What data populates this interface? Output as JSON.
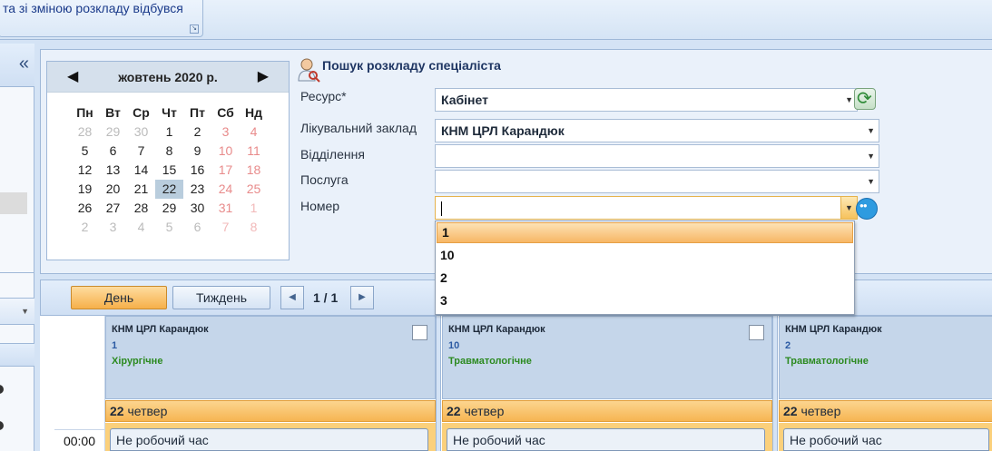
{
  "ribbon": {
    "group_text": "та  зі зміною розкладу  відбувся"
  },
  "calendar": {
    "month_title": "жовтень 2020 р.",
    "weekdays": [
      "Пн",
      "Вт",
      "Ср",
      "Чт",
      "Пт",
      "Сб",
      "Нд"
    ],
    "weeks": [
      [
        "28",
        "29",
        "30",
        "1",
        "2",
        "3",
        "4"
      ],
      [
        "5",
        "6",
        "7",
        "8",
        "9",
        "10",
        "11"
      ],
      [
        "12",
        "13",
        "14",
        "15",
        "16",
        "17",
        "18"
      ],
      [
        "19",
        "20",
        "21",
        "22",
        "23",
        "24",
        "25"
      ],
      [
        "26",
        "27",
        "28",
        "29",
        "30",
        "31",
        "1"
      ],
      [
        "2",
        "3",
        "4",
        "5",
        "6",
        "7",
        "8"
      ]
    ],
    "selected_day": "22"
  },
  "search_form": {
    "title": "Пошук розкладу спеціаліста",
    "resource_label": "Ресурс*",
    "resource_value": "Кабінет",
    "institution_label": "Лікувальний заклад",
    "institution_value": "КНМ ЦРЛ Карандюк",
    "department_label": "Відділення",
    "department_value": "",
    "service_label": "Послуга",
    "service_value": "",
    "number_label": "Номер",
    "number_value": "",
    "number_options": [
      "1",
      "10",
      "2",
      "3"
    ],
    "number_highlighted": "1"
  },
  "toolbar": {
    "day_label": "День",
    "week_label": "Тиждень",
    "page_indicator": "1 / 1"
  },
  "schedule": {
    "time_label": "00:00",
    "columns": [
      {
        "institution": "КНМ ЦРЛ Карандюк",
        "number": "1",
        "department": "Хірургічне",
        "day_num": "22",
        "day_name": "четвер",
        "slot_text": "Не робочий час"
      },
      {
        "institution": "КНМ ЦРЛ Карандюк",
        "number": "10",
        "department": "Травматологічне",
        "day_num": "22",
        "day_name": "четвер",
        "slot_text": "Не робочий час"
      },
      {
        "institution": "КНМ ЦРЛ Карандюк",
        "number": "2",
        "department": "Травматологічне",
        "day_num": "22",
        "day_name": "четвер",
        "slot_text": "Не робочий час"
      }
    ]
  },
  "colors": {
    "accent_orange": "#f6b04a",
    "panel_blue": "#d4e3f5",
    "department_green": "#2c8a20",
    "number_blue": "#2b5aa3"
  }
}
